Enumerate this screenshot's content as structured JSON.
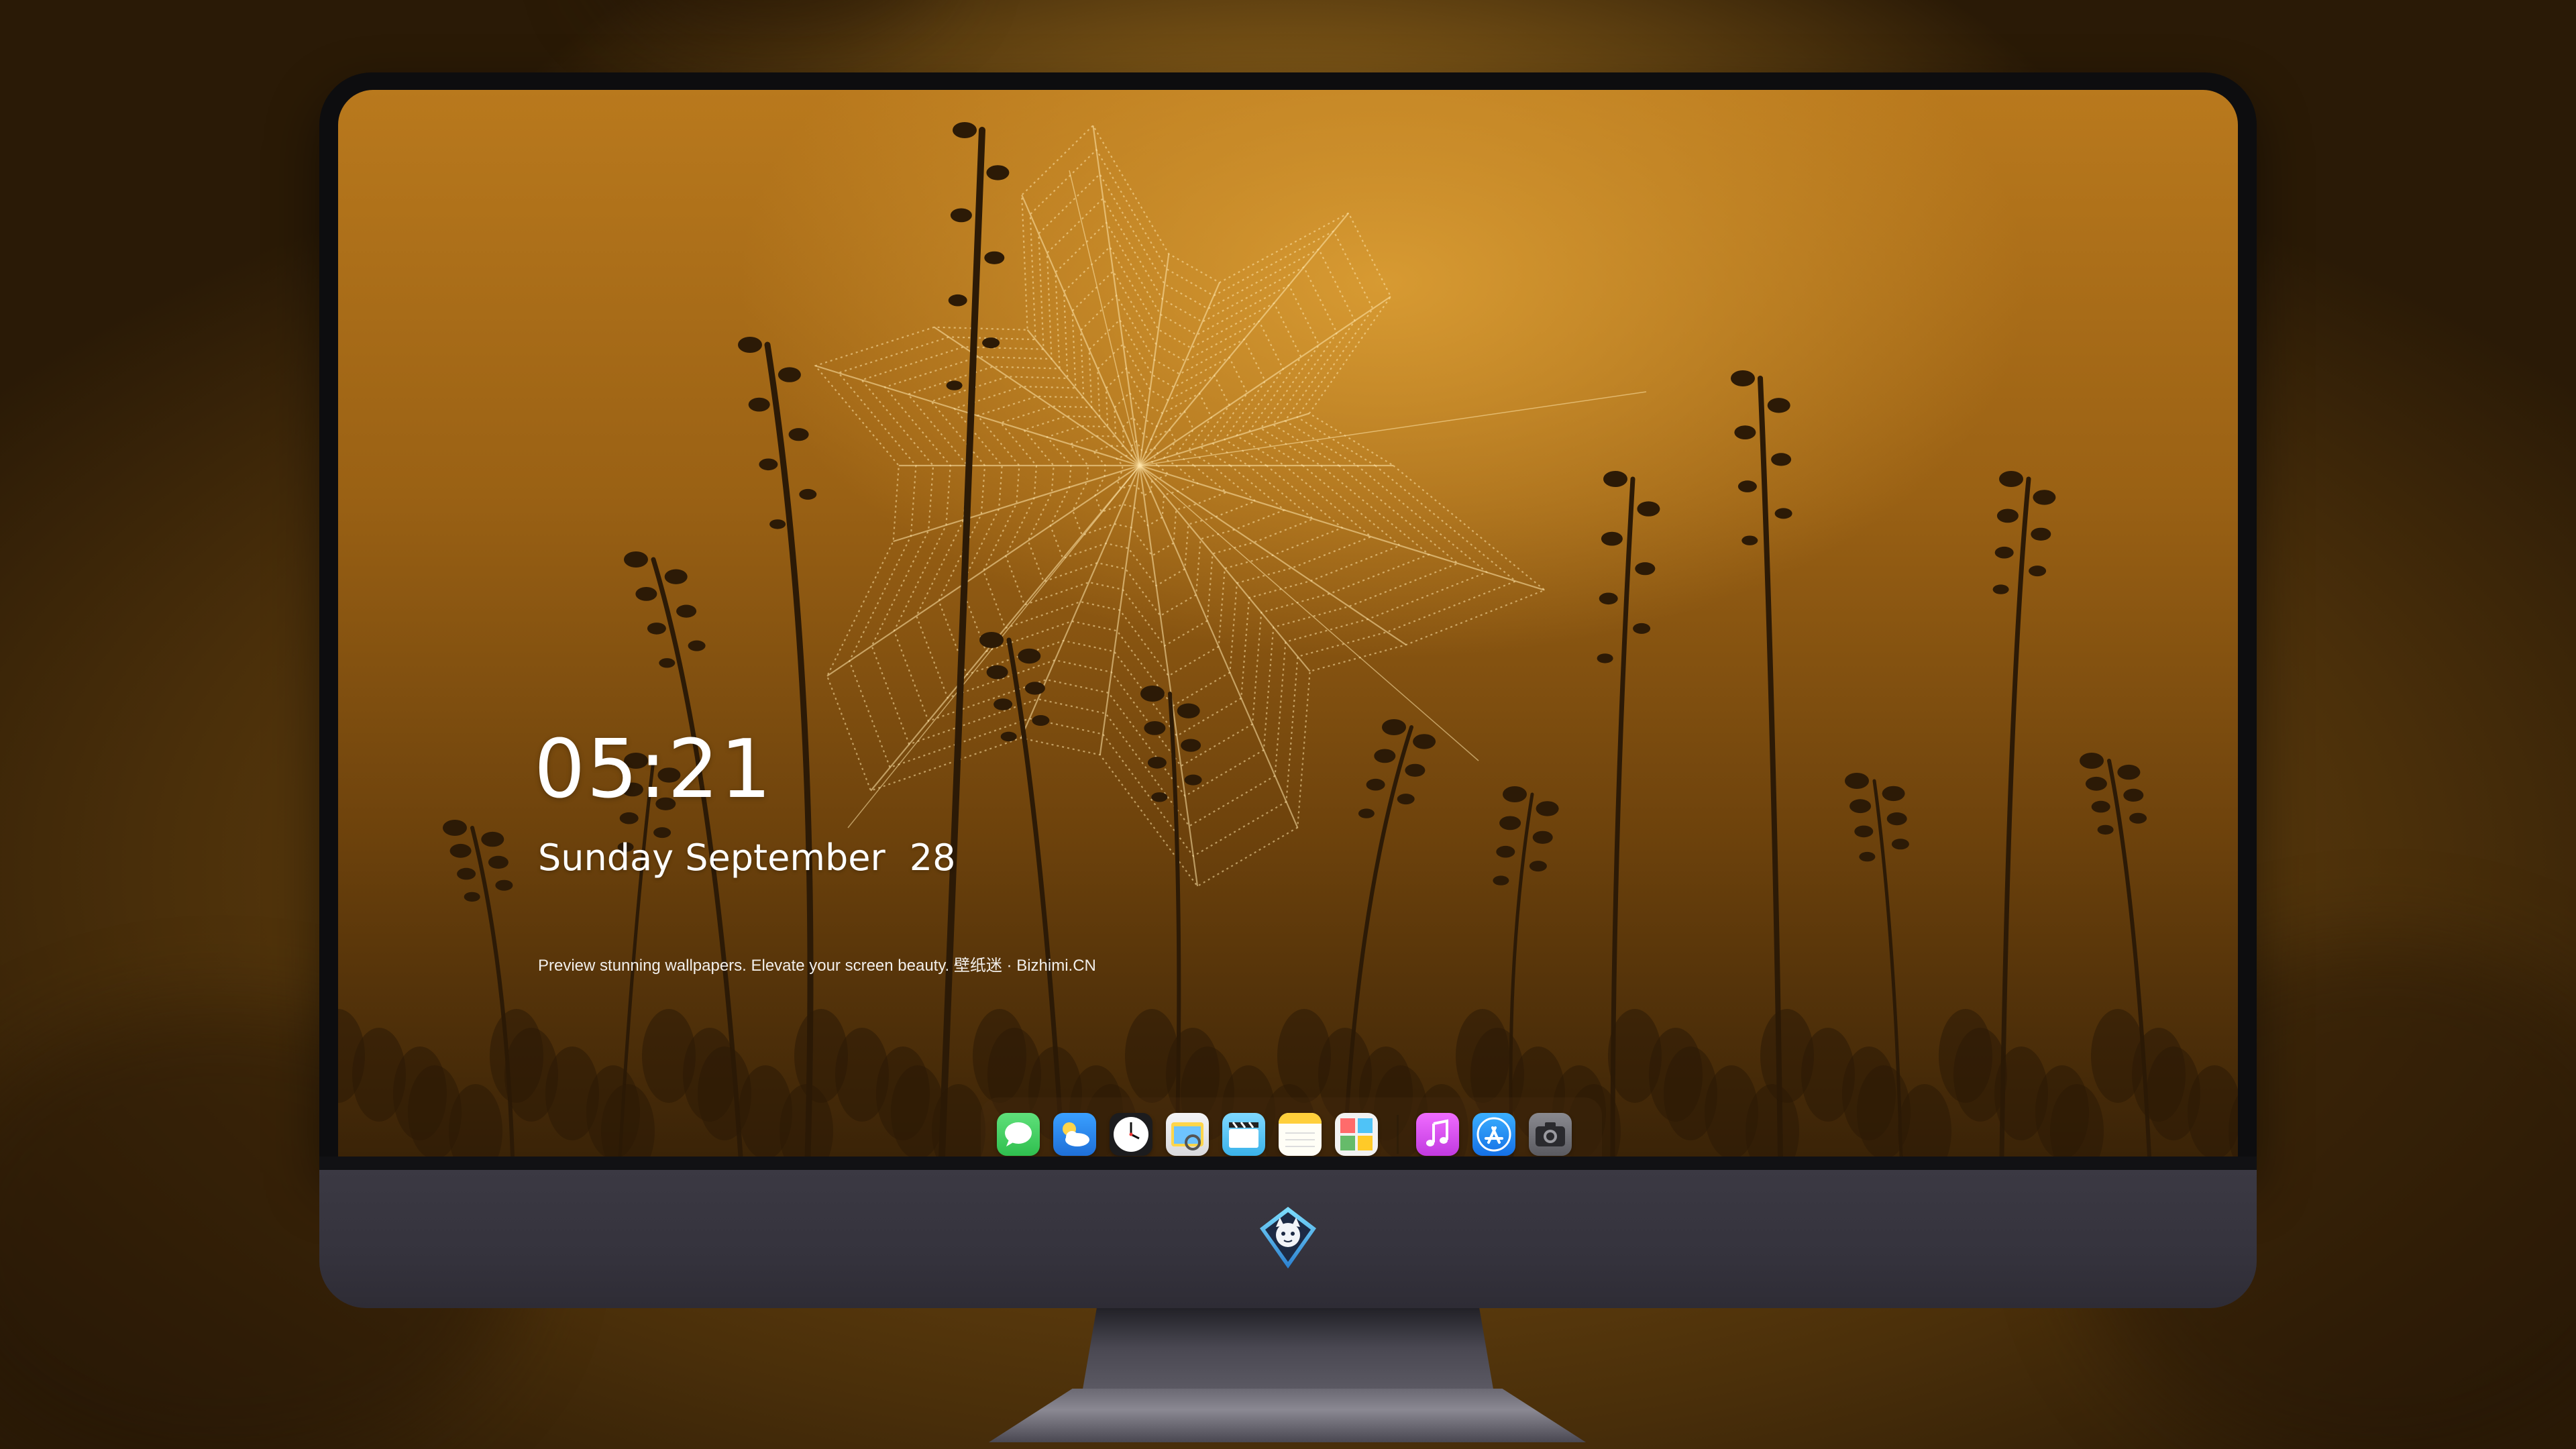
{
  "lock_screen": {
    "time": "05:21",
    "weekday": "Sunday",
    "month": "September",
    "day": "28",
    "tagline": "Preview stunning wallpapers. Elevate your screen beauty. 壁纸迷 · Bizhimi.CN"
  },
  "dock": {
    "apps": [
      {
        "icon": "messages-icon",
        "color": "#34c759"
      },
      {
        "icon": "weather-icon",
        "color": "#2f8cf0"
      },
      {
        "icon": "clock-icon",
        "color": "#1c1c1e"
      },
      {
        "icon": "preview-icon",
        "color": "#e8e8ea"
      },
      {
        "icon": "clips-icon",
        "color": "#5fc3f0"
      },
      {
        "icon": "notes-icon",
        "color": "#ffd84a"
      },
      {
        "icon": "photos-collage-icon",
        "color": "#f2f2f2"
      },
      {
        "icon": "music-icon",
        "color": "#d94cf0"
      },
      {
        "icon": "app-store-icon",
        "color": "#1e8cf5"
      },
      {
        "icon": "camera-icon",
        "color": "#6b6b70"
      }
    ]
  },
  "colors": {
    "wallpaper_glow": "#d79a32",
    "wallpaper_dark": "#3a2307",
    "bezel": "#0d0d0f",
    "chin": "#3b3943"
  }
}
